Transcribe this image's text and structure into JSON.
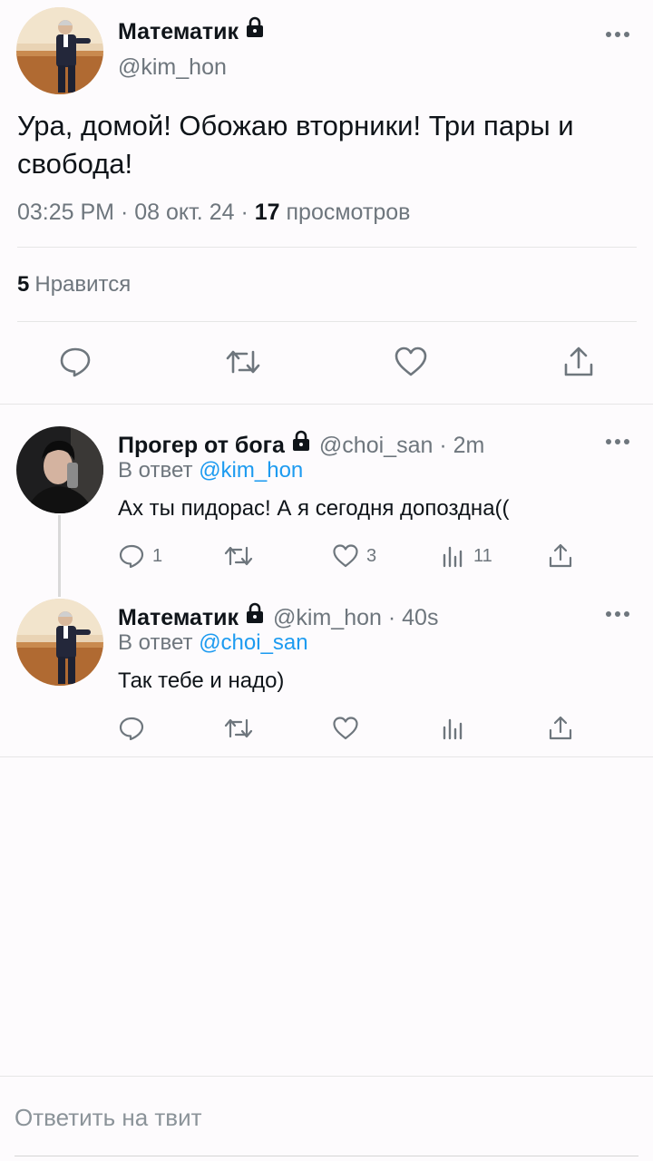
{
  "main_tweet": {
    "author_name": "Математик",
    "handle": "@kim_hon",
    "text": "Ура, домой! Обожаю вторники! Три пары и свобода!",
    "time": "03:25 PM",
    "date": "08 окт. 24",
    "views_count": "17",
    "views_label": "просмотров",
    "likes_count": "5",
    "likes_label": "Нравится",
    "actions": [
      "reply-icon",
      "retweet-icon",
      "like-icon",
      "share-icon"
    ]
  },
  "replies": [
    {
      "author_name": "Прогер от бога",
      "handle": "@choi_san",
      "age": "2m",
      "reply_prefix": "В ответ",
      "reply_to": "@kim_hon",
      "text": "Ах ты пидорас! А я сегодня допоздна((",
      "reply_count": "1",
      "retweet_count": "",
      "like_count": "3",
      "view_count": "11"
    },
    {
      "author_name": "Математик",
      "handle": "@kim_hon",
      "age": "40s",
      "reply_prefix": "В ответ",
      "reply_to": "@choi_san",
      "text": "Так тебе и надо)",
      "reply_count": "",
      "retweet_count": "",
      "like_count": "",
      "view_count": ""
    }
  ],
  "composer": {
    "placeholder": "Ответить на твит"
  },
  "colors": {
    "link": "#1d9bf0",
    "muted": "#6e767d",
    "text": "#0f1419",
    "background": "#fdfbfd"
  }
}
